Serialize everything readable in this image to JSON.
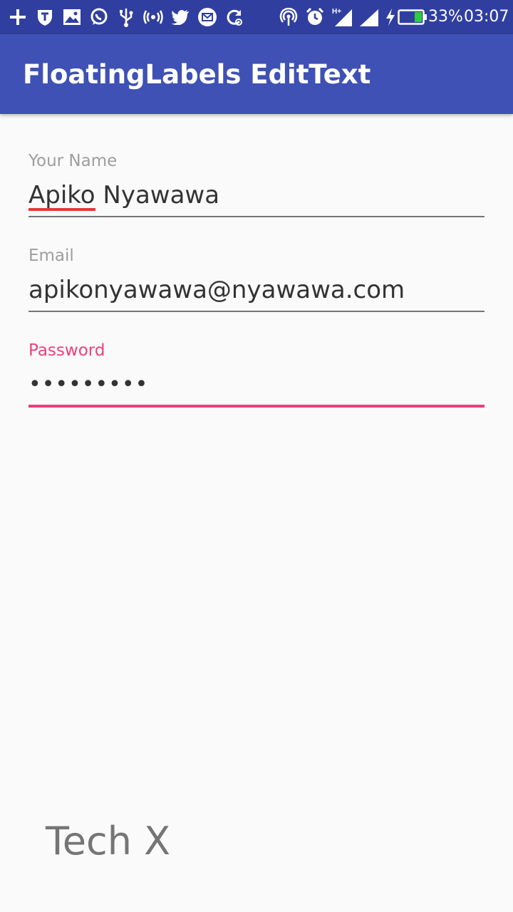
{
  "status_bar": {
    "battery_percent": "33%",
    "battery_level": 0.33,
    "time": "03:07",
    "network_type": "H+",
    "left_icons": [
      "plus-icon",
      "shield-icon",
      "image-icon",
      "whatsapp-icon",
      "usb-icon",
      "hotspot-icon",
      "twitter-icon",
      "mail-icon",
      "sync-icon"
    ],
    "right_icons": [
      "wireless-icon",
      "alarm-icon",
      "signal-icon",
      "signal-icon",
      "charging-icon",
      "battery-icon"
    ]
  },
  "app_bar": {
    "title": "FloatingLabels EditText"
  },
  "form": {
    "name": {
      "label": "Your Name",
      "value_underlined": "Apiko",
      "value_rest": " Nyawawa"
    },
    "email": {
      "label": "Email",
      "value": "apikonyawawa@nyawawa.com"
    },
    "password": {
      "label": "Password",
      "value": "•••••••••"
    }
  },
  "footer": {
    "text": "Tech X"
  },
  "colors": {
    "primary": "#3f51b5",
    "primary_dark": "#303f9f",
    "accent": "#ec407a",
    "spellcheck": "#e53935"
  }
}
